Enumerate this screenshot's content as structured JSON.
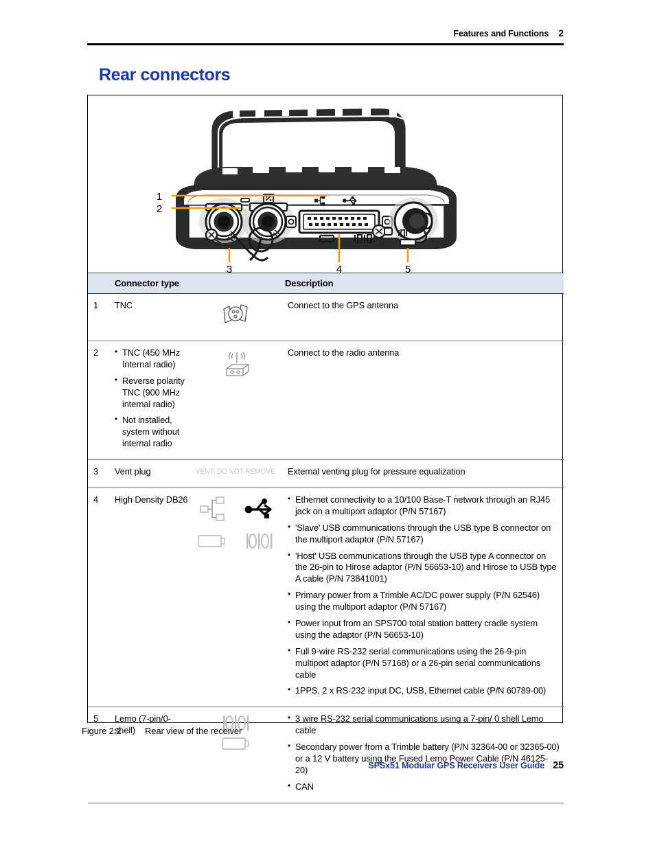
{
  "header": {
    "chapter_title": "Features and Functions",
    "chapter_number": "2"
  },
  "section": {
    "title": "Rear connectors",
    "title_color": "#1c39a8"
  },
  "figure": {
    "caption_number": "Figure 2.2",
    "caption_text": "Rear view of the receiver",
    "callouts": [
      "1",
      "2",
      "3",
      "4",
      "5"
    ],
    "callout_line_color": "#e8a500",
    "alt": "Rear view of the SPSx51 modular GPS receiver showing handle and connector panel"
  },
  "table": {
    "header_background": "#dce4ef",
    "columns": [
      "",
      "Connector type",
      "",
      "Description"
    ],
    "headers": {
      "number": "",
      "connector_type": "Connector type",
      "icon": "",
      "description": "Description"
    },
    "rows": [
      {
        "number": "1",
        "type": "TNC",
        "icons": [
          "tnc-connector-icon"
        ],
        "description_single": "Connect to the GPS antenna",
        "description_bullets": []
      },
      {
        "number": "2",
        "type_bullets": [
          "TNC (450 MHz Internal radio)",
          "Reverse polarity TNC (900 MHz internal radio)",
          "Not installed, system without internal radio"
        ],
        "icons": [
          "radio-antenna-icon"
        ],
        "description_single": "Connect to the radio antenna",
        "description_bullets": []
      },
      {
        "number": "3",
        "type": "Vent plug",
        "icons": [
          "warning-triangle-icon"
        ],
        "icon_label": "VENT: DO NOT REMOVE",
        "description_single": "External venting plug for pressure equalization",
        "description_bullets": []
      },
      {
        "number": "4",
        "type": "High Density DB26",
        "icons": [
          "ethernet-network-icon",
          "usb-icon",
          "battery-icon",
          "serial-port-icon"
        ],
        "description_single": "",
        "description_bullets": [
          "Ethernet connectivity to a 10/100 Base-T network through an RJ45 jack on a multiport adaptor (P/N 57167)",
          "'Slave' USB communications through the USB type B connector on the multiport adaptor (P/N 57167)",
          "'Host' USB communications through the USB type A connector on the 26-pin to Hirose adaptor (P/N 56653-10) and Hirose to USB type A cable (P/N 73841001)",
          "Primary power from a Trimble AC/DC power supply (P/N 62546) using the multiport adaptor (P/N 57167)",
          "Power input from an SPS700 total station battery cradle system using the adaptor (P/N 56653-10)",
          "Full 9-wire RS-232 serial communications using the 26-9-pin multiport adaptor (P/N 57168) or a 26-pin serial communications cable",
          "1PPS, 2 x RS-232 input DC, USB, Ethernet cable (P/N 60789-00)"
        ]
      },
      {
        "number": "5",
        "type": "Lemo (7-pin/0-shell)",
        "icons": [
          "serial-port-icon",
          "battery-icon"
        ],
        "description_single": "",
        "description_bullets": [
          "3 wire RS-232 serial communications using a 7-pin/ 0 shell Lemo cable",
          "Secondary power from a Trimble battery (P/N 32364-00 or 32365-00) or a 12 V battery using the Fused Lemo Power Cable (P/N 46125-20)",
          "CAN"
        ]
      }
    ]
  },
  "footer": {
    "document_title": "SPSx51 Modular GPS Receivers User Guide",
    "page_number": "25"
  }
}
